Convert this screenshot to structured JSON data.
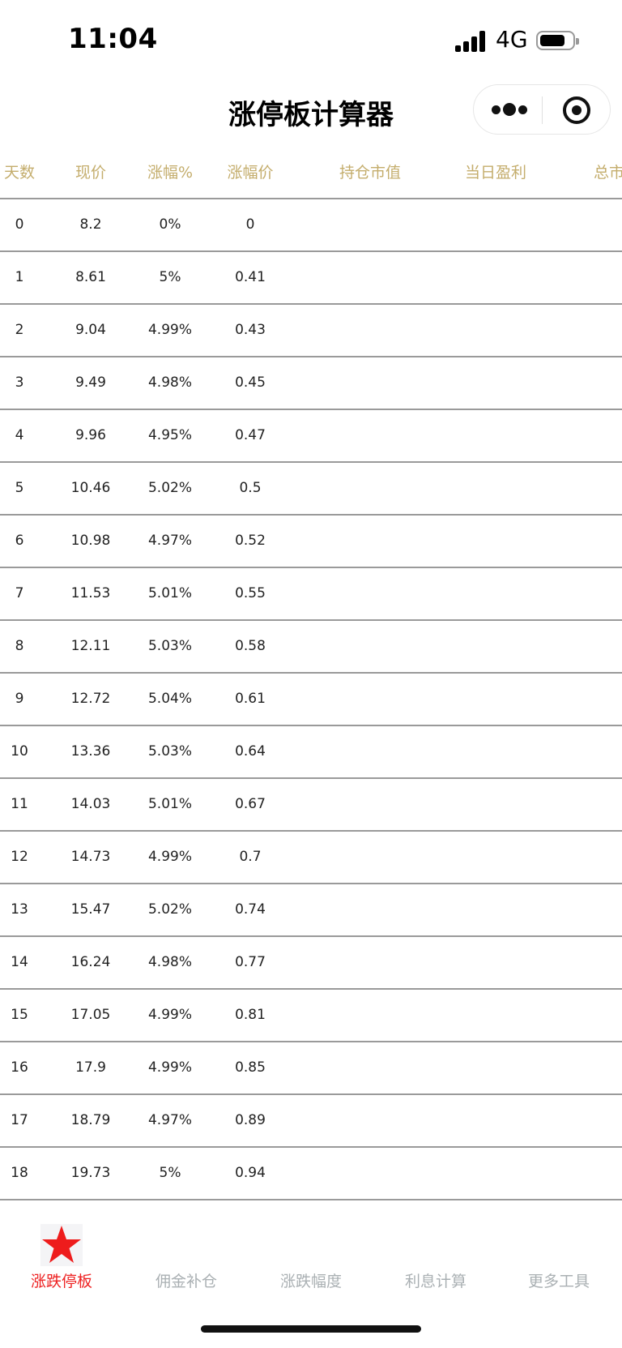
{
  "status_bar": {
    "time": "11:04",
    "network": "4G"
  },
  "nav": {
    "title": "涨停板计算器"
  },
  "table": {
    "headers": [
      "天数",
      "现价",
      "涨幅%",
      "涨幅价",
      "持仓市值",
      "当日盈利",
      "总市"
    ],
    "rows": [
      [
        "0",
        "8.2",
        "0%",
        "0"
      ],
      [
        "1",
        "8.61",
        "5%",
        "0.41"
      ],
      [
        "2",
        "9.04",
        "4.99%",
        "0.43"
      ],
      [
        "3",
        "9.49",
        "4.98%",
        "0.45"
      ],
      [
        "4",
        "9.96",
        "4.95%",
        "0.47"
      ],
      [
        "5",
        "10.46",
        "5.02%",
        "0.5"
      ],
      [
        "6",
        "10.98",
        "4.97%",
        "0.52"
      ],
      [
        "7",
        "11.53",
        "5.01%",
        "0.55"
      ],
      [
        "8",
        "12.11",
        "5.03%",
        "0.58"
      ],
      [
        "9",
        "12.72",
        "5.04%",
        "0.61"
      ],
      [
        "10",
        "13.36",
        "5.03%",
        "0.64"
      ],
      [
        "11",
        "14.03",
        "5.01%",
        "0.67"
      ],
      [
        "12",
        "14.73",
        "4.99%",
        "0.7"
      ],
      [
        "13",
        "15.47",
        "5.02%",
        "0.74"
      ],
      [
        "14",
        "16.24",
        "4.98%",
        "0.77"
      ],
      [
        "15",
        "17.05",
        "4.99%",
        "0.81"
      ],
      [
        "16",
        "17.9",
        "4.99%",
        "0.85"
      ],
      [
        "17",
        "18.79",
        "4.97%",
        "0.89"
      ],
      [
        "18",
        "19.73",
        "5%",
        "0.94"
      ]
    ]
  },
  "tabs": [
    {
      "label": "涨跌停板",
      "active": true,
      "icon": "star-icon"
    },
    {
      "label": "佣金补仓",
      "active": false
    },
    {
      "label": "涨跌幅度",
      "active": false
    },
    {
      "label": "利息计算",
      "active": false
    },
    {
      "label": "更多工具",
      "active": false
    }
  ],
  "colors": {
    "header_text": "#c4ad6c",
    "active_tab": "#ee2222",
    "inactive_tab": "#aab0b3",
    "divider": "#9a9a9a"
  }
}
